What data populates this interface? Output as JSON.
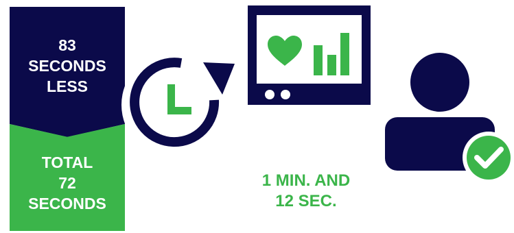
{
  "time_saved": {
    "lines": [
      "83",
      "SECONDS",
      "LESS"
    ]
  },
  "total_time": {
    "lines": [
      "TOTAL",
      "72",
      "SECONDS"
    ]
  },
  "duration_caption": {
    "lines": [
      "1 MIN. AND",
      "12 SEC."
    ]
  },
  "colors": {
    "navy": "#0b0a4a",
    "green": "#3bb54a",
    "white": "#ffffff"
  },
  "icons": [
    "clock-refresh-icon",
    "monitor-icon",
    "heart-icon",
    "bar-chart-icon",
    "user-icon",
    "check-badge-icon"
  ]
}
